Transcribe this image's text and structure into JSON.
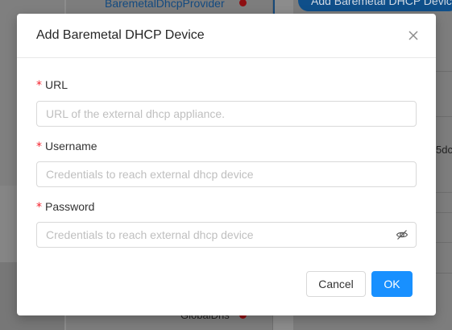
{
  "background": {
    "top_label": "BaremetalDhcpProvider",
    "top_button_label": "Add Baremetal DHCP Device",
    "right_partial_text": "5dc",
    "bottom_partial_text": "GlobalDns"
  },
  "modal": {
    "title": "Add Baremetal DHCP Device",
    "close_icon": "close-icon",
    "fields": {
      "url": {
        "label": "URL",
        "required_mark": "*",
        "value": "",
        "placeholder": "URL of the external dhcp appliance."
      },
      "username": {
        "label": "Username",
        "required_mark": "*",
        "value": "",
        "placeholder": "Credentials to reach external dhcp device"
      },
      "password": {
        "label": "Password",
        "required_mark": "*",
        "value": "",
        "placeholder": "Credentials to reach external dhcp device",
        "toggle_icon": "eye-invisible-icon"
      }
    },
    "buttons": {
      "cancel": "Cancel",
      "ok": "OK"
    }
  },
  "colors": {
    "primary": "#1890ff",
    "required": "#f5222d",
    "status_dot": "#d9363e"
  }
}
